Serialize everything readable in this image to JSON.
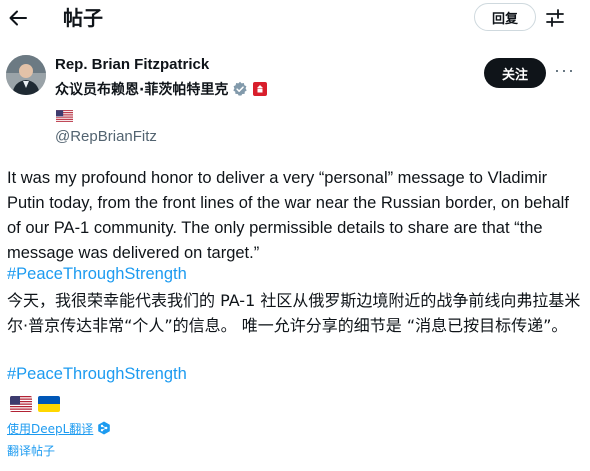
{
  "header": {
    "title": "帖子",
    "reply_label": "回复",
    "back_icon": "arrow-left-icon",
    "filter_icon": "sliders-icon"
  },
  "author": {
    "name": "Rep. Brian Fitzpatrick",
    "translated_name": "众议员布赖恩·菲茨帕特里克",
    "handle": "@RepBrianFitz",
    "verified_color": "#829aab",
    "gov_badge_color": "#d81e2b"
  },
  "actions": {
    "follow_label": "关注",
    "more_label": "···"
  },
  "tweet": {
    "text_en": "It was my profound honor to deliver a very “personal” message to Vladimir Putin today, from the front lines of the war near the Russian border, on behalf of our PA-1 community.  The only permissible details to share are that “the message was delivered on target.”",
    "hashtag_en": "#PeaceThroughStrength",
    "text_cn": "今天，我很荣幸能代表我们的 PA-1 社区从俄罗斯边境附近的战争前线向弗拉基米尔·普京传达非常“个人”的信息。 唯一允许分享的细节是 “消息已按目标传递”。",
    "hashtag_cn": "#PeaceThroughStrength",
    "flags": [
      "us-flag",
      "ukraine-flag"
    ]
  },
  "translation": {
    "deepl_label": "使用DeepL翻译",
    "translate_label": "翻译帖子"
  },
  "colors": {
    "link": "#1d9bf0",
    "text": "#0f1419",
    "muted": "#536471"
  }
}
